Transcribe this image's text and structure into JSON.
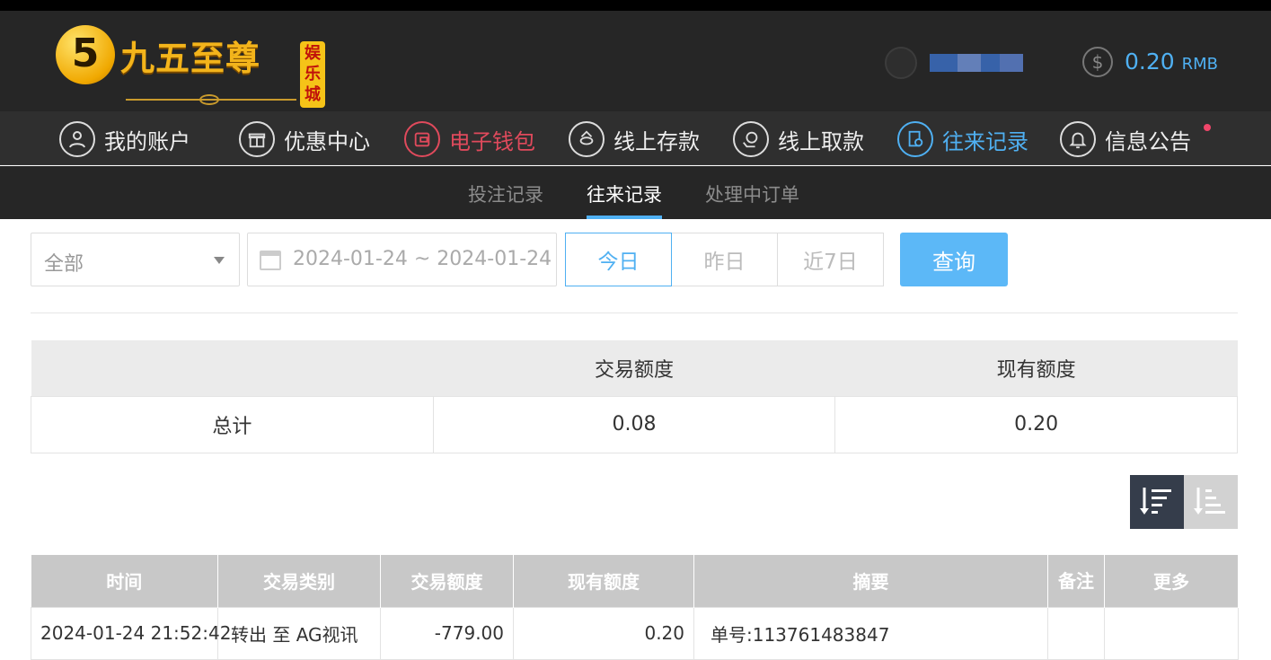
{
  "header": {
    "logo_numeral": "5",
    "logo_text": "九五至尊",
    "logo_badge": [
      "娱",
      "乐",
      "城"
    ],
    "balance_icon": "$",
    "balance_amount": "0.20",
    "balance_currency": "RMB"
  },
  "nav": {
    "items": [
      {
        "label": "我的账户",
        "icon": "user-icon"
      },
      {
        "label": "优惠中心",
        "icon": "gift-icon"
      },
      {
        "label": "电子钱包",
        "icon": "wallet-icon"
      },
      {
        "label": "线上存款",
        "icon": "deposit-icon"
      },
      {
        "label": "线上取款",
        "icon": "withdraw-icon"
      },
      {
        "label": "往来记录",
        "icon": "records-icon"
      },
      {
        "label": "信息公告",
        "icon": "bell-icon"
      }
    ]
  },
  "subnav": {
    "items": [
      "投注记录",
      "往来记录",
      "处理中订单"
    ],
    "active": "往来记录"
  },
  "filters": {
    "type_value": "全部",
    "date_range": "2024-01-24 ~ 2024-01-24",
    "quick_dates": [
      "今日",
      "昨日",
      "近7日"
    ],
    "active_quick_date": "今日",
    "query_label": "查询"
  },
  "summary": {
    "headers": [
      "",
      "交易额度",
      "现有额度"
    ],
    "row": {
      "label": "总计",
      "transaction_amount": "0.08",
      "current_amount": "0.20"
    }
  },
  "records": {
    "headers": [
      "时间",
      "交易类别",
      "交易额度",
      "现有额度",
      "摘要",
      "备注",
      "更多"
    ],
    "rows": [
      {
        "time": "2024-01-24 21:52:42",
        "type": "转出 至 AG视讯",
        "amount": "-779.00",
        "balance": "0.20",
        "summary": "单号:113761483847",
        "remark": "",
        "more": ""
      }
    ]
  },
  "colors": {
    "accent": "#4fb0f2",
    "wallet_active": "#e04a5c",
    "header_bg": "#262626"
  }
}
